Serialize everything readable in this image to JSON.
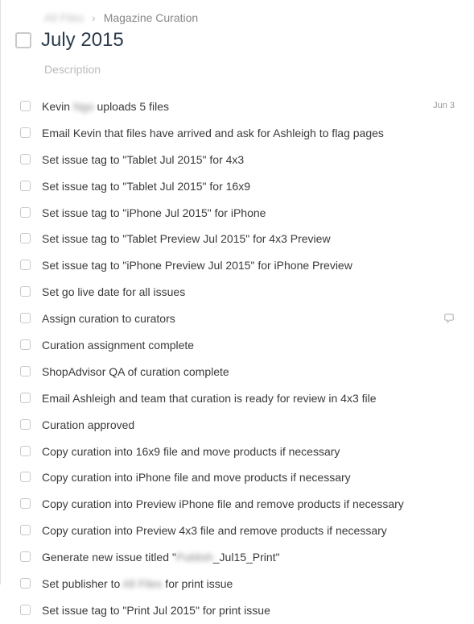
{
  "breadcrumb": {
    "parent": "All Files",
    "separator": "›",
    "current": "Magazine Curation"
  },
  "title": "July 2015",
  "description_placeholder": "Description",
  "tasks": [
    {
      "text_before": "Kevin ",
      "blur": "Ngo",
      "text_after": " uploads 5 files",
      "date": "Jun 3"
    },
    {
      "text": "Email Kevin that files have arrived and ask for Ashleigh to flag pages"
    },
    {
      "text": "Set issue tag to \"Tablet Jul 2015\" for 4x3"
    },
    {
      "text": "Set issue tag to \"Tablet Jul 2015\" for 16x9"
    },
    {
      "text": "Set issue tag to \"iPhone Jul 2015\" for iPhone"
    },
    {
      "text": "Set issue tag to \"Tablet Preview Jul 2015\" for 4x3 Preview"
    },
    {
      "text": "Set issue tag to \"iPhone Preview Jul 2015\" for iPhone Preview"
    },
    {
      "text": "Set go live date for all issues"
    },
    {
      "text": "Assign curation to curators",
      "has_comment": true
    },
    {
      "text": "Curation assignment complete"
    },
    {
      "text": "ShopAdvisor QA of curation complete"
    },
    {
      "text": "Email Ashleigh and team that curation is ready for review in 4x3 file"
    },
    {
      "text": "Curation approved"
    },
    {
      "text": "Copy curation into 16x9 file and move products if necessary"
    },
    {
      "text": "Copy curation into iPhone file and move products if necessary"
    },
    {
      "text": "Copy curation into Preview iPhone file and remove products if necessary"
    },
    {
      "text": "Copy curation into Preview 4x3 file and remove products if necessary"
    },
    {
      "text_before": "Generate new issue titled \"",
      "blur": "Publish",
      "text_after": "_Jul15_Print\""
    },
    {
      "text_before": "Set publisher to ",
      "blur": "All Files",
      "text_after": " for print issue"
    },
    {
      "text": "Set issue tag to \"Print Jul 2015\" for print issue"
    }
  ]
}
